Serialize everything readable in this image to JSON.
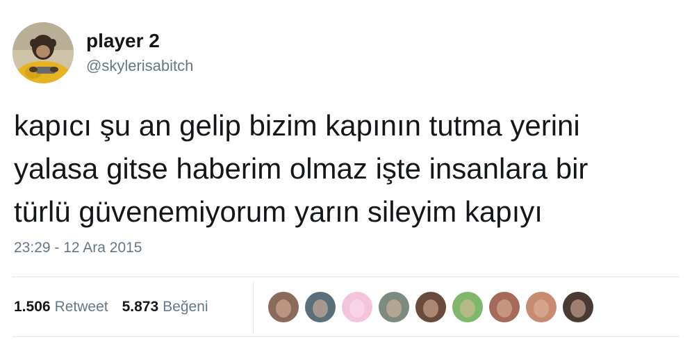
{
  "user": {
    "display_name": "player 2",
    "handle": "@skylerisabitch",
    "avatar_icon": "monkey-avatar"
  },
  "tweet": {
    "lines": [
      "kapıcı şu an gelip bizim kapının tutma yerini",
      "yalasa gitse haberim olmaz işte insanlara bir",
      "türlü güvenemiyorum yarın sileyim kapıyı"
    ],
    "timestamp": "23:29 - 12 Ara 2015"
  },
  "stats": {
    "retweet_count": "1.506",
    "retweet_label": "Retweet",
    "like_count": "5.873",
    "like_label": "Beğeni"
  },
  "likers": [
    {
      "name": "liker-avatar-1",
      "color": "#8a6a5c"
    },
    {
      "name": "liker-avatar-2",
      "color": "#5a6f7a"
    },
    {
      "name": "liker-avatar-3",
      "color": "#f4c4dc"
    },
    {
      "name": "liker-avatar-4",
      "color": "#7d8a80"
    },
    {
      "name": "liker-avatar-5",
      "color": "#6b4a3e"
    },
    {
      "name": "liker-avatar-6",
      "color": "#7fb86a"
    },
    {
      "name": "liker-avatar-7",
      "color": "#a56a5a"
    },
    {
      "name": "liker-avatar-8",
      "color": "#c88a70"
    },
    {
      "name": "liker-avatar-9",
      "color": "#4a3a34"
    }
  ],
  "colors": {
    "text": "#14171a",
    "secondary": "#657786",
    "divider": "#e1e8ed"
  }
}
